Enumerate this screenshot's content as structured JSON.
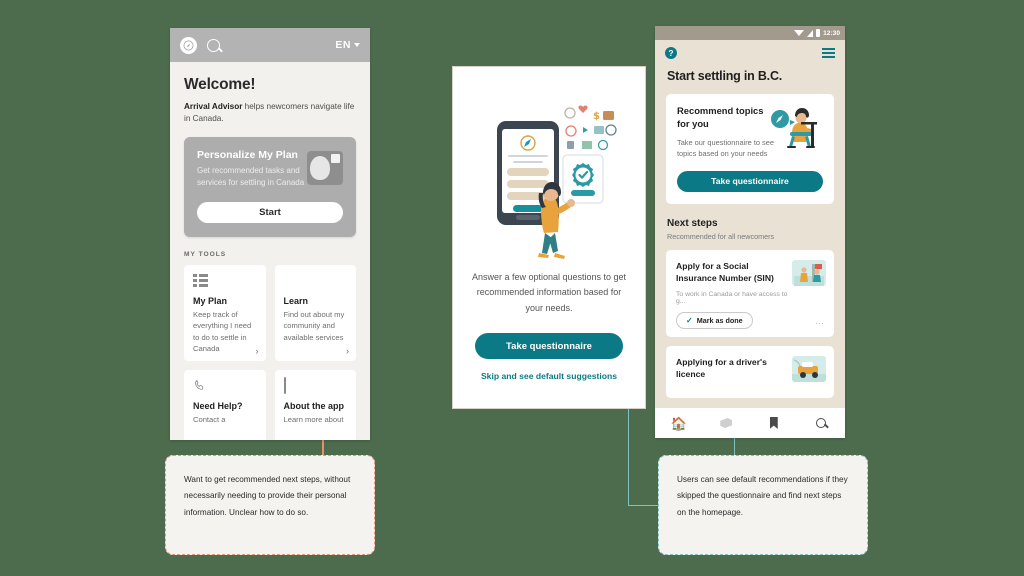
{
  "canvas": {
    "background": "#4d6b4d"
  },
  "colors": {
    "teal": "#0b7a86",
    "orange": "#ef8d6a",
    "light_teal": "#7cc4c2",
    "grey_appbar": "#b3b3b3",
    "tan": "#e9e2d4"
  },
  "phone_left": {
    "appbar": {
      "compass_icon": "compass-icon",
      "search_icon": "search-icon",
      "language": "EN",
      "caret_icon": "chevron-down-icon"
    },
    "heading": "Welcome!",
    "intro_bold": "Arrival Advisor",
    "intro_rest": " helps newcomers navigate life in Canada.",
    "promo": {
      "title": "Personalize My Plan",
      "body": "Get recommended tasks and services for settling in Canada",
      "button": "Start",
      "illustration": "person-with-document-illustration"
    },
    "tools_label": "MY TOOLS",
    "tools": [
      {
        "icon": "list-icon",
        "title": "My Plan",
        "body": "Keep track of everything I need to do to settle in Canada",
        "chevron": "›"
      },
      {
        "icon": "book-icon",
        "title": "Learn",
        "body": "Find out about my community and available services",
        "chevron": "›"
      },
      {
        "icon": "phone-icon",
        "title": "Need Help?",
        "body": "Contact a",
        "chevron": ""
      },
      {
        "icon": "mobile-icon",
        "title": "About the app",
        "body": "Learn more about",
        "chevron": ""
      }
    ]
  },
  "panel_mid": {
    "illustration": "woman-with-phone-and-checkmark-illustration",
    "body": "Answer a few optional questions to get recommended information based for your needs.",
    "primary_button": "Take questionnaire",
    "secondary_link": "Skip and see default suggestions"
  },
  "phone_right": {
    "statusbar": {
      "wifi_icon": "wifi-icon",
      "signal_icon": "signal-icon",
      "battery_icon": "battery-icon",
      "time": "12:30"
    },
    "topbar": {
      "help_icon": "help-circle-icon",
      "help_label": "?",
      "menu_icon": "hamburger-menu-icon"
    },
    "title": "Start settling in B.C.",
    "recommend_card": {
      "title": "Recommend topics for you",
      "body": "Take our questionnaire to see topics based on your needs",
      "button": "Take questionnaire",
      "illustration": "person-at-desk-illustration"
    },
    "next_steps_heading": "Next steps",
    "next_steps_sub": "Recommended for all newcomers",
    "steps": [
      {
        "title": "Apply for a Social Insurance Number (SIN)",
        "desc": "To work in Canada or have access to g...",
        "chip": "Mark as done",
        "chip_icon": "check-icon",
        "overflow_icon": "more-horizontal-icon",
        "thumb": "sin-card-illustration"
      },
      {
        "title": "Applying for a driver's licence",
        "desc": "",
        "chip": "",
        "chip_icon": "",
        "overflow_icon": "",
        "thumb": "driving-illustration"
      }
    ],
    "tabbar": [
      {
        "icon": "home-icon",
        "active": true
      },
      {
        "icon": "book-icon",
        "active": false
      },
      {
        "icon": "bookmark-icon",
        "active": false
      },
      {
        "icon": "search-icon",
        "active": false
      }
    ]
  },
  "annotations": {
    "left": "Want to get recommended next steps, without necessarily needing to provide their personal information. Unclear how to do so.",
    "right": "Users can see default recommendations if they skipped the questionnaire and find next steps on the homepage."
  }
}
